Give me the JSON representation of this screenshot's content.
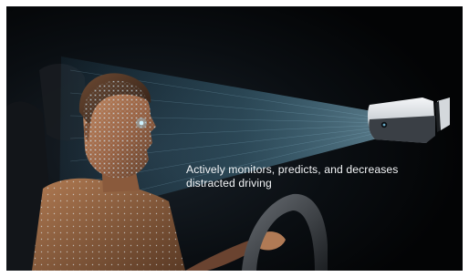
{
  "caption": "Actively monitors, predicts, and decreases distracted driving",
  "colors": {
    "background": "#05070a",
    "scan_beam": "#6fc3e8",
    "face_mesh": "#bfe9ff",
    "sensor_body": "#d9dde1"
  },
  "objects": {
    "driver": "driver-silhouette",
    "face_mesh": "face-scan-mesh",
    "camera": "driver-monitoring-camera",
    "steering_wheel": "steering-wheel"
  }
}
